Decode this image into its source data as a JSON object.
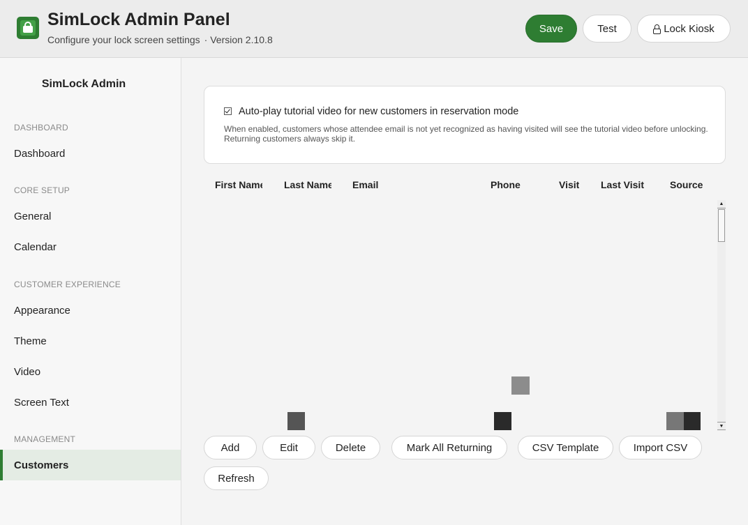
{
  "header": {
    "title": "SimLock Admin Panel",
    "subtitle": "Configure your lock screen settings",
    "version": "· Version 2.10.8",
    "buttons": {
      "save": "Save",
      "test": "Test",
      "lock": "Lock Kiosk"
    }
  },
  "sidebar": {
    "brand": "SimLock Admin",
    "sections": {
      "dashboard": "DASHBOARD",
      "core": "CORE SETUP",
      "cx": "CUSTOMER EXPERIENCE",
      "management": "MANAGEMENT"
    },
    "items": {
      "dashboard": "Dashboard",
      "general": "General",
      "calendar": "Calendar",
      "appearance": "Appearance",
      "theme": "Theme",
      "video": "Video",
      "screen_text": "Screen Text",
      "customers": "Customers"
    },
    "active_item": "Customers"
  },
  "tutorial": {
    "checked": true,
    "label": "Auto-play tutorial video for new customers in reservation mode",
    "description": "When enabled, customers whose attendee email is not yet recognized as having visited will see the tutorial video before unlocking. Returning customers always skip it."
  },
  "table": {
    "columns": {
      "first_name": "First Name",
      "last_name": "Last Name",
      "email": "Email",
      "phone": "Phone",
      "visits": "Visits",
      "last_visit": "Last Visit",
      "source": "Source"
    },
    "scroll": {
      "up": "▲",
      "down": "▼"
    }
  },
  "actions": {
    "add": "Add",
    "edit": "Edit",
    "delete": "Delete",
    "mark_all": "Mark All Returning",
    "csv_template": "CSV Template",
    "import_csv": "Import CSV",
    "refresh": "Refresh"
  },
  "colors": {
    "accent": "#2e7d32",
    "active_bg": "#e4ece4"
  }
}
